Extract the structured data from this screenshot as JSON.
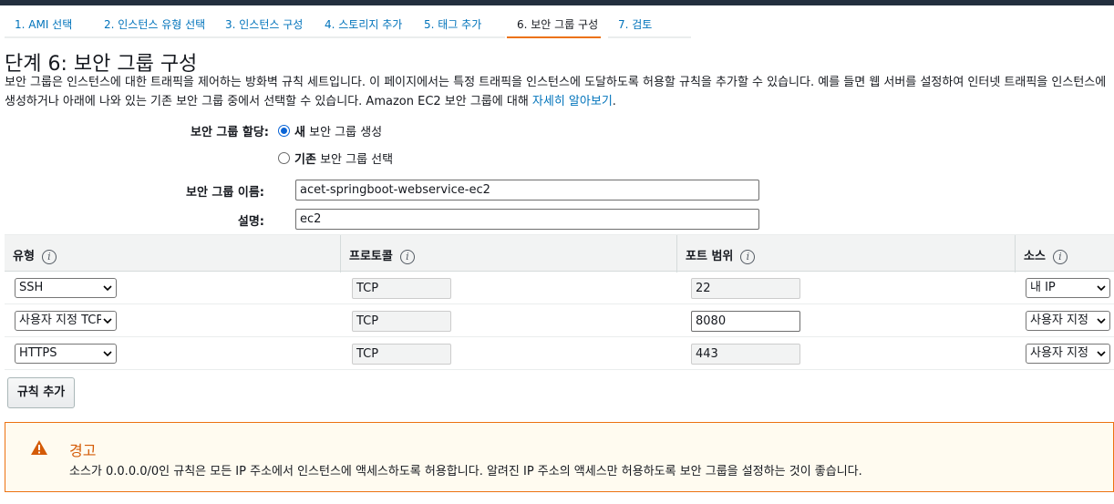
{
  "tabs": [
    {
      "label": "1. AMI 선택"
    },
    {
      "label": "2. 인스턴스 유형 선택"
    },
    {
      "label": "3. 인스턴스 구성"
    },
    {
      "label": "4. 스토리지 추가"
    },
    {
      "label": "5. 태그 추가"
    },
    {
      "label": "6. 보안 그룹 구성"
    },
    {
      "label": "7. 검토"
    }
  ],
  "page": {
    "title": "단계 6: 보안 그룹 구성",
    "desc_line1": "보안 그룹은 인스턴스에 대한 트래픽을 제어하는 방화벽 규칙 세트입니다. 이 페이지에서는 특정 트래픽을 인스턴스에 도달하도록 허용할 규칙을 추가할 수 있습니다. 예를 들면 웹 서버를 설정하여 인터넷 트래픽을 인스턴스에",
    "desc_line2": "생성하거나 아래에 나와 있는 기존 보안 그룹 중에서 선택할 수 있습니다. Amazon EC2 보안 그룹에 대해",
    "learn_more": "자세히 알아보기",
    "period": "."
  },
  "form": {
    "assign_label": "보안 그룹 할당:",
    "option_new_bold": "새",
    "option_new_rest": "보안 그룹 생성",
    "option_existing_bold": "기존",
    "option_existing_rest": "보안 그룹 선택",
    "name_label": "보안 그룹 이름:",
    "name_value": "acet-springboot-webservice-ec2",
    "desc_label": "설명:",
    "desc_value": "ec2"
  },
  "rules": {
    "headers": {
      "type": "유형",
      "protocol": "프로토콜",
      "port": "포트 범위",
      "source": "소스"
    },
    "rows": [
      {
        "type": "SSH",
        "protocol": "TCP",
        "port": "22",
        "source": "내 IP"
      },
      {
        "type": "사용자 지정 TCP",
        "protocol": "TCP",
        "port": "8080",
        "source": "사용자 지정"
      },
      {
        "type": "HTTPS",
        "protocol": "TCP",
        "port": "443",
        "source": "사용자 지정"
      }
    ],
    "add_rule": "규칙 추가"
  },
  "warning": {
    "title": "경고",
    "text": "소스가 0.0.0.0/0인 규칙은 모든 IP 주소에서 인스턴스에 액세스하도록 허용합니다. 알려진 IP 주소의 액세스만 허용하도록 보안 그룹을 설정하는 것이 좋습니다."
  },
  "colors": {
    "link": "#0073bb",
    "accent": "#ec7211",
    "warning_bg": "#fffbf0"
  }
}
